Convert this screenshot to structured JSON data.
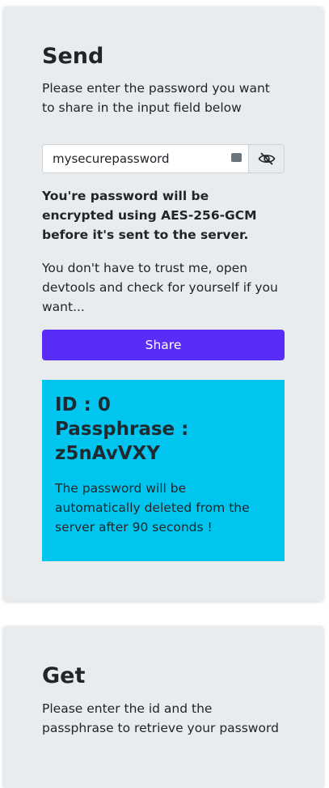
{
  "send": {
    "title": "Send",
    "description": "Please enter the password you want to share in the input field below",
    "password_value": "mysecurepassword",
    "toggle_icon": "eye-slash-icon",
    "encryption_note": "You're password will be encrypted using AES-256-GCM before it's sent to the server.",
    "trust_note": "You don't have to trust me, open devtools and check for yourself if you want...",
    "share_label": "Share",
    "accent_color": "#5a2cf7",
    "result": {
      "id_line": "ID : 0",
      "passphrase_label": "Passphrase :",
      "passphrase_value": "z5nAvVXY",
      "expiry_note": "The password will be automatically deleted from the server after 90 seconds !",
      "background_color": "#00c6ef"
    }
  },
  "get": {
    "title": "Get",
    "description": "Please enter the id and the passphrase to retrieve your password"
  }
}
